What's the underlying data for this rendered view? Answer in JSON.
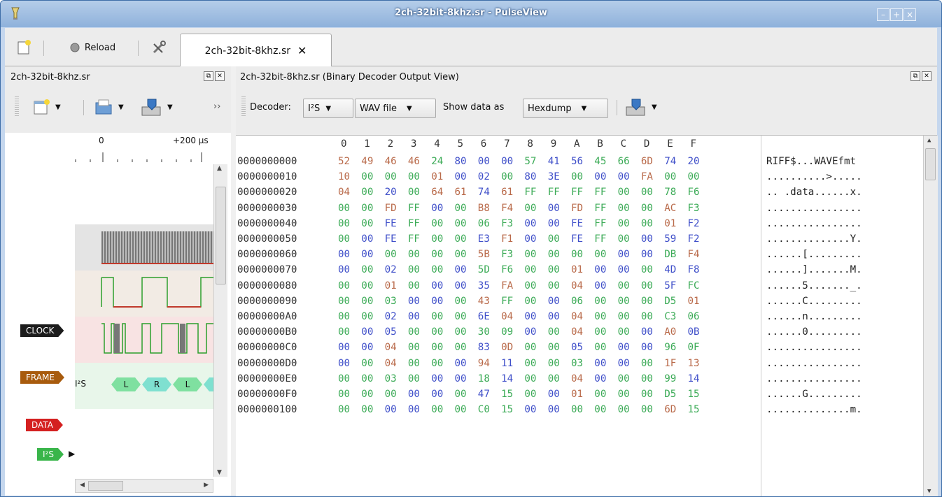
{
  "window": {
    "title": "2ch-32bit-8khz.sr - PulseView",
    "controls": [
      "–",
      "+",
      "×"
    ]
  },
  "toolbar": {
    "reload_label": "Reload",
    "tab_label": "2ch-32bit-8khz.sr",
    "tab_close_glyph": "✕"
  },
  "left_panel": {
    "title": "2ch-32bit-8khz.sr",
    "overflow_glyph": "››",
    "ruler": {
      "tick_0": "0",
      "tick_1": "+200 µs"
    },
    "signals": [
      {
        "name": "CLOCK",
        "color": "#1c1c1c"
      },
      {
        "name": "FRAME",
        "color": "#a85b0d"
      },
      {
        "name": "DATA",
        "color": "#d42020"
      },
      {
        "name": "I²S",
        "color": "#39b54a"
      }
    ],
    "decoder_row": {
      "label": "I²S",
      "annotations": [
        "L",
        "R",
        "L"
      ]
    }
  },
  "right_panel": {
    "title": "2ch-32bit-8khz.sr (Binary Decoder Output View)",
    "decoder_label": "Decoder:",
    "decoder_value": "I²S",
    "output_value": "WAV file",
    "show_label": "Show data as",
    "show_value": "Hexdump"
  },
  "hexdump": {
    "columns": [
      "0",
      "1",
      "2",
      "3",
      "4",
      "5",
      "6",
      "7",
      "8",
      "9",
      "A",
      "B",
      "C",
      "D",
      "E",
      "F"
    ],
    "rows": [
      {
        "addr": "0000000000",
        "bytes": [
          "52",
          "49",
          "46",
          "46",
          "24",
          "80",
          "00",
          "00",
          "57",
          "41",
          "56",
          "45",
          "66",
          "6D",
          "74",
          "20"
        ],
        "ascii": "RIFF$...WAVEfmt "
      },
      {
        "addr": "0000000010",
        "bytes": [
          "10",
          "00",
          "00",
          "00",
          "01",
          "00",
          "02",
          "00",
          "80",
          "3E",
          "00",
          "00",
          "00",
          "FA",
          "00",
          "00"
        ],
        "ascii": "..........>....."
      },
      {
        "addr": "0000000020",
        "bytes": [
          "04",
          "00",
          "20",
          "00",
          "64",
          "61",
          "74",
          "61",
          "FF",
          "FF",
          "FF",
          "FF",
          "00",
          "00",
          "78",
          "F6"
        ],
        "ascii": ".. .data......x."
      },
      {
        "addr": "0000000030",
        "bytes": [
          "00",
          "00",
          "FD",
          "FF",
          "00",
          "00",
          "B8",
          "F4",
          "00",
          "00",
          "FD",
          "FF",
          "00",
          "00",
          "AC",
          "F3"
        ],
        "ascii": "................"
      },
      {
        "addr": "0000000040",
        "bytes": [
          "00",
          "00",
          "FE",
          "FF",
          "00",
          "00",
          "06",
          "F3",
          "00",
          "00",
          "FE",
          "FF",
          "00",
          "00",
          "01",
          "F2"
        ],
        "ascii": "................"
      },
      {
        "addr": "0000000050",
        "bytes": [
          "00",
          "00",
          "FE",
          "FF",
          "00",
          "00",
          "E3",
          "F1",
          "00",
          "00",
          "FE",
          "FF",
          "00",
          "00",
          "59",
          "F2"
        ],
        "ascii": "..............Y."
      },
      {
        "addr": "0000000060",
        "bytes": [
          "00",
          "00",
          "00",
          "00",
          "00",
          "00",
          "5B",
          "F3",
          "00",
          "00",
          "00",
          "00",
          "00",
          "00",
          "DB",
          "F4"
        ],
        "ascii": "......[........."
      },
      {
        "addr": "0000000070",
        "bytes": [
          "00",
          "00",
          "02",
          "00",
          "00",
          "00",
          "5D",
          "F6",
          "00",
          "00",
          "01",
          "00",
          "00",
          "00",
          "4D",
          "F8"
        ],
        "ascii": "......].......M."
      },
      {
        "addr": "0000000080",
        "bytes": [
          "00",
          "00",
          "01",
          "00",
          "00",
          "00",
          "35",
          "FA",
          "00",
          "00",
          "04",
          "00",
          "00",
          "00",
          "5F",
          "FC"
        ],
        "ascii": "......5......._."
      },
      {
        "addr": "0000000090",
        "bytes": [
          "00",
          "00",
          "03",
          "00",
          "00",
          "00",
          "43",
          "FF",
          "00",
          "00",
          "06",
          "00",
          "00",
          "00",
          "D5",
          "01"
        ],
        "ascii": "......C........."
      },
      {
        "addr": "00000000A0",
        "bytes": [
          "00",
          "00",
          "02",
          "00",
          "00",
          "00",
          "6E",
          "04",
          "00",
          "00",
          "04",
          "00",
          "00",
          "00",
          "C3",
          "06"
        ],
        "ascii": "......n........."
      },
      {
        "addr": "00000000B0",
        "bytes": [
          "00",
          "00",
          "05",
          "00",
          "00",
          "00",
          "30",
          "09",
          "00",
          "00",
          "04",
          "00",
          "00",
          "00",
          "A0",
          "0B"
        ],
        "ascii": "......0........."
      },
      {
        "addr": "00000000C0",
        "bytes": [
          "00",
          "00",
          "04",
          "00",
          "00",
          "00",
          "83",
          "0D",
          "00",
          "00",
          "05",
          "00",
          "00",
          "00",
          "96",
          "0F"
        ],
        "ascii": "................"
      },
      {
        "addr": "00000000D0",
        "bytes": [
          "00",
          "00",
          "04",
          "00",
          "00",
          "00",
          "94",
          "11",
          "00",
          "00",
          "03",
          "00",
          "00",
          "00",
          "1F",
          "13"
        ],
        "ascii": "................"
      },
      {
        "addr": "00000000E0",
        "bytes": [
          "00",
          "00",
          "03",
          "00",
          "00",
          "00",
          "18",
          "14",
          "00",
          "00",
          "04",
          "00",
          "00",
          "00",
          "99",
          "14"
        ],
        "ascii": "................"
      },
      {
        "addr": "00000000F0",
        "bytes": [
          "00",
          "00",
          "00",
          "00",
          "00",
          "00",
          "47",
          "15",
          "00",
          "00",
          "01",
          "00",
          "00",
          "00",
          "D5",
          "15"
        ],
        "ascii": "......G........."
      },
      {
        "addr": "0000000100",
        "bytes": [
          "00",
          "00",
          "00",
          "00",
          "00",
          "00",
          "C0",
          "15",
          "00",
          "00",
          "00",
          "00",
          "00",
          "00",
          "6D",
          "15"
        ],
        "ascii": "..............m."
      }
    ],
    "byte_colors": [
      "#3cab57",
      "#b96a4a",
      "#3f4fc9"
    ]
  }
}
